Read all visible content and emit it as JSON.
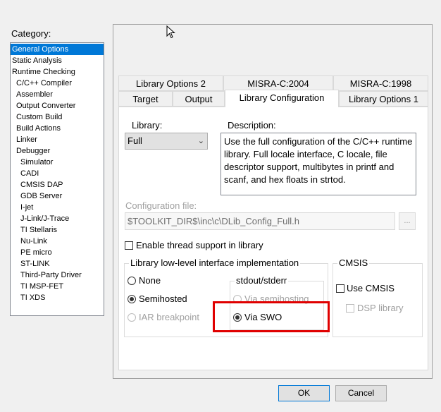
{
  "category": {
    "label": "Category:",
    "items": [
      {
        "label": "General Options",
        "level": 0,
        "selected": true
      },
      {
        "label": "Static Analysis",
        "level": 0
      },
      {
        "label": "Runtime Checking",
        "level": 0
      },
      {
        "label": "C/C++ Compiler",
        "level": 1
      },
      {
        "label": "Assembler",
        "level": 1
      },
      {
        "label": "Output Converter",
        "level": 1
      },
      {
        "label": "Custom Build",
        "level": 1
      },
      {
        "label": "Build Actions",
        "level": 1
      },
      {
        "label": "Linker",
        "level": 1
      },
      {
        "label": "Debugger",
        "level": 1
      },
      {
        "label": "Simulator",
        "level": 2
      },
      {
        "label": "CADI",
        "level": 2
      },
      {
        "label": "CMSIS DAP",
        "level": 2
      },
      {
        "label": "GDB Server",
        "level": 2
      },
      {
        "label": "I-jet",
        "level": 2
      },
      {
        "label": "J-Link/J-Trace",
        "level": 2
      },
      {
        "label": "TI Stellaris",
        "level": 2
      },
      {
        "label": "Nu-Link",
        "level": 2
      },
      {
        "label": "PE micro",
        "level": 2
      },
      {
        "label": "ST-LINK",
        "level": 2
      },
      {
        "label": "Third-Party Driver",
        "level": 2
      },
      {
        "label": "TI MSP-FET",
        "level": 2
      },
      {
        "label": "TI XDS",
        "level": 2
      }
    ]
  },
  "tabs": {
    "row_top": [
      "Library Options 2",
      "MISRA-C:2004",
      "MISRA-C:1998"
    ],
    "row_bottom": [
      "Target",
      "Output",
      "Library Configuration",
      "Library Options 1"
    ],
    "active": "Library Configuration"
  },
  "library": {
    "label": "Library:",
    "value": "Full",
    "description_label": "Description:",
    "description": "Use the full configuration of the C/C++ runtime library. Full locale interface, C locale, file descriptor support, multibytes in printf and scanf, and hex floats in strtod."
  },
  "config_file": {
    "label": "Configuration file:",
    "value": "$TOOLKIT_DIR$\\inc\\c\\DLib_Config_Full.h",
    "browse_label": "..."
  },
  "thread_support": {
    "label": "Enable thread support in library",
    "checked": false
  },
  "low_level": {
    "title": "Library low-level interface implementation",
    "options": [
      {
        "label": "None",
        "selected": false,
        "enabled": true
      },
      {
        "label": "Semihosted",
        "selected": true,
        "enabled": true
      },
      {
        "label": "IAR breakpoint",
        "selected": false,
        "enabled": false
      }
    ],
    "stdout": {
      "title": "stdout/stderr",
      "options": [
        {
          "label": "Via semihosting",
          "selected": false
        },
        {
          "label": "Via SWO",
          "selected": true
        }
      ]
    }
  },
  "cmsis": {
    "title": "CMSIS",
    "use_label": "Use CMSIS",
    "dsp_label": "DSP library"
  },
  "buttons": {
    "ok": "OK",
    "cancel": "Cancel"
  },
  "highlight_color": "#e00000"
}
